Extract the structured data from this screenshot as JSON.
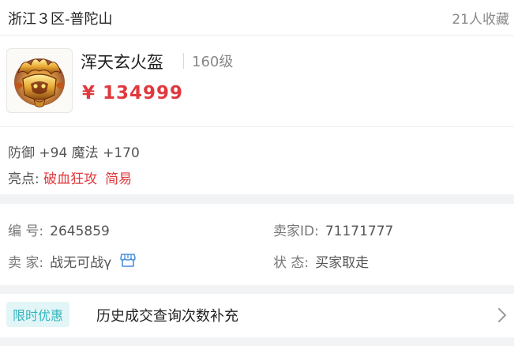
{
  "header": {
    "server": "浙江３区-普陀山",
    "favorites": "21人收藏"
  },
  "item": {
    "name": "浑天玄火盔",
    "level": "160级",
    "price": "¥ 134999",
    "icon": "golden-helmet-image"
  },
  "attributes": {
    "stats": "防御 +94 魔法 +170",
    "highlight_label": "亮点:",
    "highlights": [
      "破血狂攻",
      "简易"
    ]
  },
  "info": {
    "number_label": "编 号:",
    "number_value": "2645859",
    "seller_id_label": "卖家ID:",
    "seller_id_value": "71171777",
    "seller_label": "卖 家:",
    "seller_value": "战无可战γ",
    "seller_icon": "shop-icon",
    "status_label": "状 态:",
    "status_value": "买家取走"
  },
  "promo": {
    "tag": "限时优惠",
    "text": "历史成交查询次数补充",
    "icon": "chevron-right-icon"
  },
  "colors": {
    "price": "#e0393e",
    "accent": "#33b5be",
    "tag_bg": "#e3f6f7"
  }
}
